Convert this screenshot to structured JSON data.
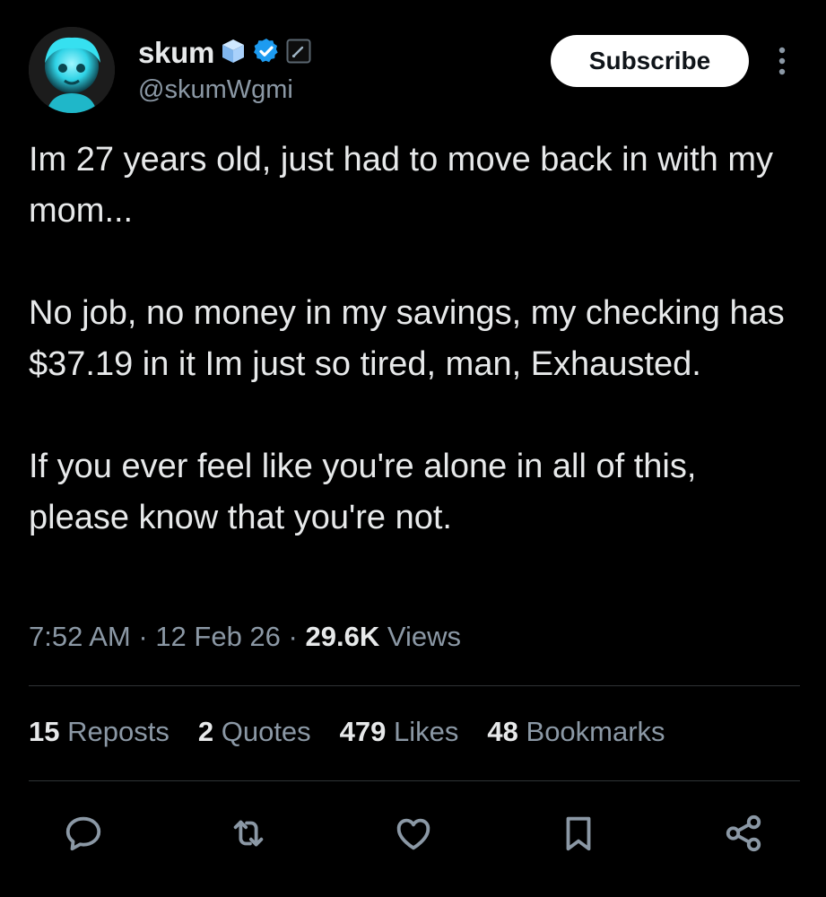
{
  "author": {
    "display_name": "skum",
    "handle": "@skumWgmi"
  },
  "subscribe_label": "Subscribe",
  "tweet": {
    "paragraphs": [
      "Im 27 years old, just had to move back in with my mom...",
      "No job, no money in my savings, my checking has $37.19 in it Im just so tired, man, Exhausted.",
      "If you ever feel like you're alone in all of this, please know that you're not."
    ],
    "time": "7:52 AM",
    "date": "12 Feb 26",
    "views_count": "29.6K",
    "views_label": "Views"
  },
  "stats": {
    "reposts_count": "15",
    "reposts_label": "Reposts",
    "quotes_count": "2",
    "quotes_label": "Quotes",
    "likes_count": "479",
    "likes_label": "Likes",
    "bookmarks_count": "48",
    "bookmarks_label": "Bookmarks"
  },
  "icons": {
    "verified": "verified-badge-icon",
    "cube": "cube-emoji-icon",
    "pen": "pen-badge-icon",
    "more": "more-vertical-icon",
    "reply": "reply-icon",
    "repost": "repost-icon",
    "like": "heart-icon",
    "bookmark": "bookmark-icon",
    "share": "share-icon"
  },
  "colors": {
    "background": "#000000",
    "text_primary": "#e7e9ea",
    "text_secondary": "#8b98a5",
    "verified_blue": "#1d9bf0",
    "divider": "#2f3336"
  }
}
